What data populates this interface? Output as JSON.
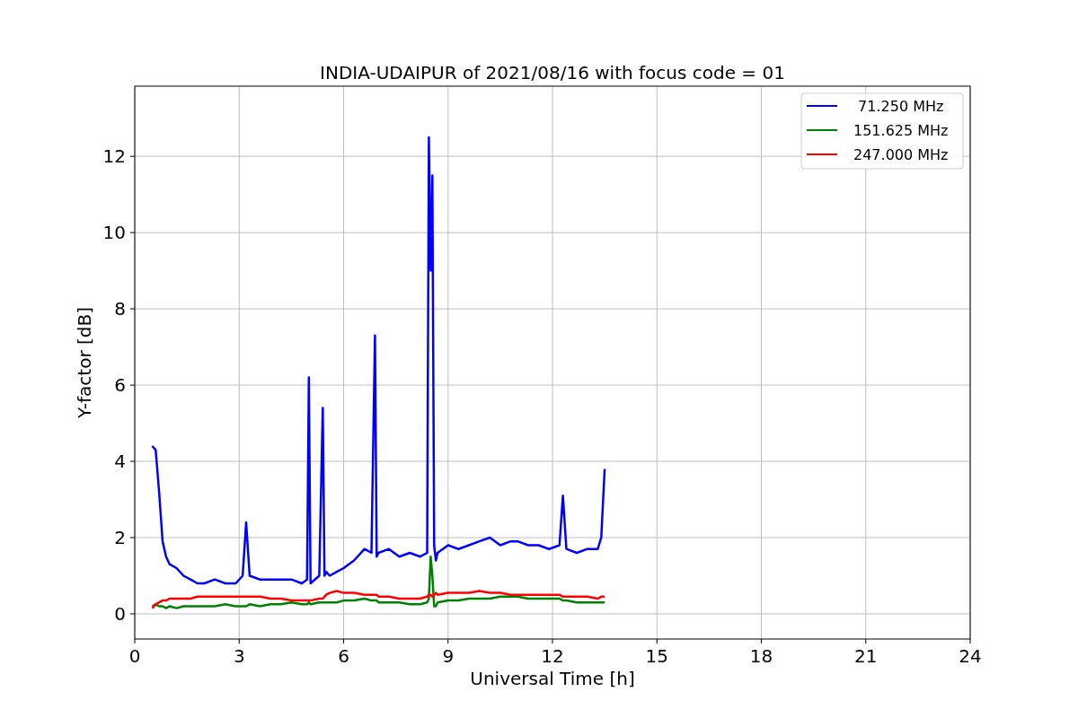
{
  "chart_data": {
    "type": "line",
    "title": "INDIA-UDAIPUR of 2021/08/16 with focus code = 01",
    "xlabel": "Universal Time [h]",
    "ylabel": "Y-factor [dB]",
    "x": [
      0.5,
      0.6,
      0.7,
      0.8,
      0.9,
      1.0,
      1.2,
      1.4,
      1.6,
      1.8,
      2.0,
      2.3,
      2.6,
      2.9,
      3.1,
      3.2,
      3.3,
      3.6,
      3.9,
      4.2,
      4.5,
      4.8,
      4.95,
      5.0,
      5.05,
      5.3,
      5.4,
      5.45,
      5.5,
      5.6,
      5.8,
      6.0,
      6.3,
      6.6,
      6.8,
      6.9,
      6.95,
      7.0,
      7.3,
      7.6,
      7.9,
      8.2,
      8.4,
      8.45,
      8.5,
      8.55,
      8.6,
      8.65,
      8.7,
      9.0,
      9.3,
      9.6,
      9.9,
      10.2,
      10.5,
      10.8,
      11.0,
      11.3,
      11.6,
      11.9,
      12.2,
      12.3,
      12.4,
      12.7,
      13.0,
      13.3,
      13.4,
      13.5
    ],
    "series": [
      {
        "name": " 71.250 MHz",
        "color": "#0000ff",
        "values": [
          4.4,
          4.3,
          3.2,
          1.9,
          1.5,
          1.3,
          1.2,
          1.0,
          0.9,
          0.8,
          0.8,
          0.9,
          0.8,
          0.8,
          1.0,
          2.4,
          1.0,
          0.9,
          0.9,
          0.9,
          0.9,
          0.8,
          0.9,
          6.2,
          0.8,
          1.0,
          5.4,
          1.0,
          1.1,
          1.0,
          1.1,
          1.2,
          1.4,
          1.7,
          1.6,
          7.3,
          1.5,
          1.6,
          1.7,
          1.5,
          1.6,
          1.5,
          1.6,
          12.5,
          9.0,
          11.5,
          1.8,
          1.4,
          1.6,
          1.8,
          1.7,
          1.8,
          1.9,
          2.0,
          1.8,
          1.9,
          1.9,
          1.8,
          1.8,
          1.7,
          1.8,
          3.1,
          1.7,
          1.6,
          1.7,
          1.7,
          2.0,
          3.8
        ]
      },
      {
        "name": "151.625 MHz",
        "color": "#008000",
        "values": [
          0.2,
          0.25,
          0.2,
          0.2,
          0.15,
          0.2,
          0.15,
          0.2,
          0.2,
          0.2,
          0.2,
          0.2,
          0.25,
          0.2,
          0.2,
          0.2,
          0.25,
          0.2,
          0.25,
          0.25,
          0.3,
          0.25,
          0.25,
          0.3,
          0.25,
          0.3,
          0.3,
          0.3,
          0.3,
          0.3,
          0.3,
          0.35,
          0.35,
          0.4,
          0.35,
          0.35,
          0.35,
          0.3,
          0.3,
          0.3,
          0.25,
          0.25,
          0.3,
          0.4,
          1.5,
          1.0,
          0.2,
          0.2,
          0.3,
          0.35,
          0.35,
          0.4,
          0.4,
          0.4,
          0.45,
          0.45,
          0.45,
          0.4,
          0.4,
          0.4,
          0.4,
          0.35,
          0.35,
          0.3,
          0.3,
          0.3,
          0.3,
          0.3
        ]
      },
      {
        "name": "247.000 MHz",
        "color": "#ff0000",
        "values": [
          0.15,
          0.25,
          0.3,
          0.35,
          0.35,
          0.4,
          0.4,
          0.4,
          0.4,
          0.45,
          0.45,
          0.45,
          0.45,
          0.45,
          0.45,
          0.45,
          0.45,
          0.45,
          0.4,
          0.4,
          0.35,
          0.35,
          0.35,
          0.35,
          0.35,
          0.4,
          0.4,
          0.45,
          0.5,
          0.55,
          0.6,
          0.55,
          0.55,
          0.5,
          0.5,
          0.5,
          0.5,
          0.45,
          0.45,
          0.4,
          0.4,
          0.4,
          0.45,
          0.5,
          0.5,
          0.45,
          0.5,
          0.55,
          0.5,
          0.55,
          0.55,
          0.55,
          0.6,
          0.55,
          0.55,
          0.5,
          0.5,
          0.5,
          0.5,
          0.5,
          0.5,
          0.45,
          0.45,
          0.45,
          0.45,
          0.4,
          0.45,
          0.45
        ]
      }
    ],
    "xlim": [
      0,
      24
    ],
    "ylim": [
      -0.66,
      13.84
    ],
    "xticks": [
      0,
      3,
      6,
      9,
      12,
      15,
      18,
      21,
      24
    ],
    "yticks": [
      0,
      2,
      4,
      6,
      8,
      10,
      12
    ],
    "grid": true,
    "legend": "upper right"
  }
}
